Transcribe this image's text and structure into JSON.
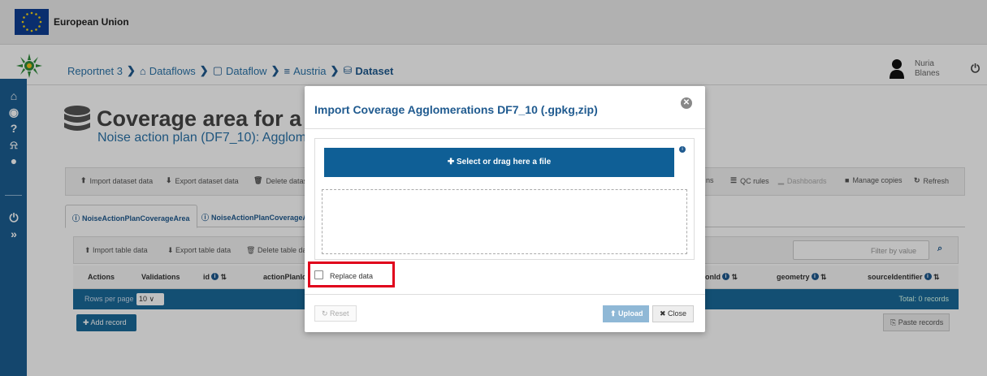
{
  "eu_banner": {
    "title": "European Union"
  },
  "nav": {
    "breadcrumb": {
      "root": "Reportnet 3",
      "dataflows": "Dataflows",
      "dataflow": "Dataflow",
      "country": "Austria",
      "dataset": "Dataset"
    },
    "user": {
      "first_name": "Nuria",
      "last_name": "Blanes"
    }
  },
  "page": {
    "title": "Coverage area for a",
    "subtitle": "Noise action plan (DF7_10): Agglom"
  },
  "toolbar": {
    "import_dataset": "Import dataset data",
    "export_dataset": "Export dataset data",
    "delete_dataset": "Delete datas",
    "validations": "ns",
    "qc_rules": "QC rules",
    "dashboards": "Dashboards",
    "manage_copies": "Manage copies",
    "refresh": "Refresh"
  },
  "tabs": [
    {
      "label": "NoiseActionPlanCoverageArea"
    },
    {
      "label": "NoiseActionPlanCoverageA"
    }
  ],
  "table_toolbar": {
    "import_table": "Import table data",
    "export_table": "Export table data",
    "delete_table": "Delete table da",
    "filter_placeholder": "Filter by value"
  },
  "table": {
    "columns": [
      "Actions",
      "Validations",
      "id",
      "actionPlanIc",
      "onId",
      "geometry",
      "sourceIdentifier"
    ],
    "rows_per_page_label": "Rows per page",
    "rows_per_page_value": "10",
    "total": "Total: 0 records",
    "add_record": "Add record",
    "paste_records": "Paste records"
  },
  "dialog": {
    "title": "Import Coverage Agglomerations DF7_10 (.gpkg,zip)",
    "select_file": "Select or drag here a file",
    "replace_label": "Replace data",
    "replace_checked": false,
    "reset": "Reset",
    "upload": "Upload",
    "close": "Close"
  },
  "colors": {
    "primary": "#0f5f96",
    "sidebar": "#1b5e92",
    "highlight": "#e0001b"
  }
}
